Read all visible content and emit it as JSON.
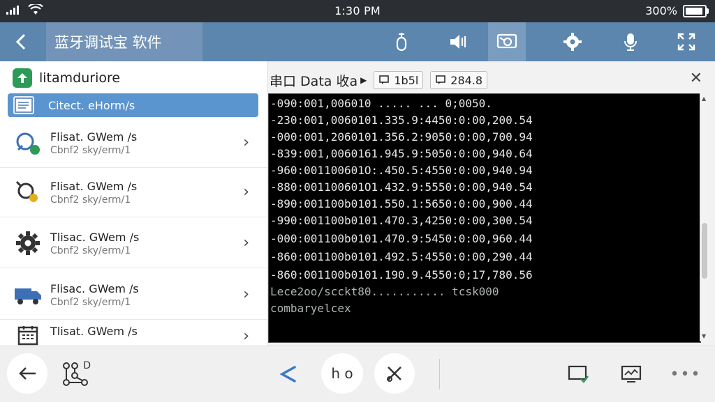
{
  "status_bar": {
    "time": "1:30 PM",
    "battery": "300%"
  },
  "app_bar": {
    "title": "蓝牙调试宝 软件"
  },
  "sidebar": {
    "header": "litamduriore",
    "selected_label": "Citect. eHorm/s",
    "items": [
      {
        "title": "Flisat. GWem /s",
        "subtitle": "Cbnf2 sky/erm/1"
      },
      {
        "title": "Flisat. GWem /s",
        "subtitle": "Cbnf2 sky/erm/1"
      },
      {
        "title": "Tlisac. GWem /s",
        "subtitle": "Cbnf2 sky/erm/1"
      },
      {
        "title": "Flisac. GWem /s",
        "subtitle": "Cbnf2 sky/erm/1"
      },
      {
        "title": "Tlisat. GWem /s",
        "subtitle": ""
      }
    ]
  },
  "panel": {
    "title": "串口 Data 收a",
    "box1_label": "1b5l",
    "box2_label": "284.8",
    "terminal_lines": [
      "-090:001,006010 ..... ... 0;0050.",
      "-230:001,0060101.335.9:4450:0:00,200.54",
      "-000:001,2060101.356.2:9050:0:00,700.94",
      "-839:001,0060161.945.9:5050:0:00,940.64",
      "-960:001100601O:.450.5:4550:0:00,940.94",
      "-880:001100601O1.432.9:5550:0:00,940.54",
      "-890:001100b0101.550.1:5650:0:00,900.44",
      "-990:001100b0101.470.3,4250:0:00,300.54",
      "-000:001100b0101.470.9:5450:0:00,960.44",
      "-860:001100b0101.492.5:4550:0:00,290.44",
      "-860:001100b0101.190.9.4550:0;17,780.56",
      "Lece2oo/scckt80........... tcsk000",
      "combaryelcex"
    ]
  },
  "bottom_bar": {
    "center_label": "h o",
    "nodes_letter": "D"
  }
}
